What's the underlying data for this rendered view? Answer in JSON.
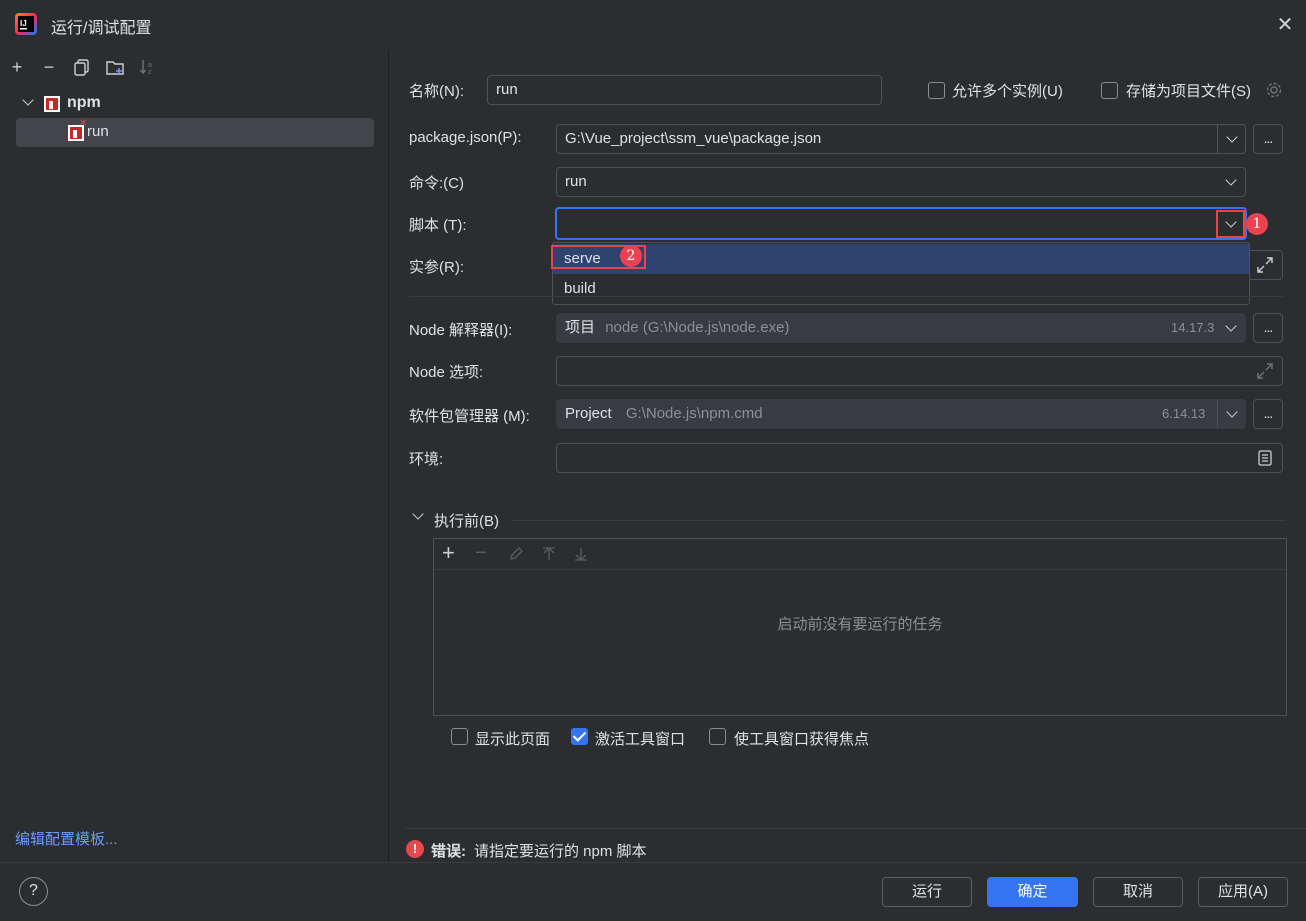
{
  "window": {
    "title": "运行/调试配置"
  },
  "tree": {
    "group_label": "npm",
    "config_label": "run"
  },
  "left_footer": {
    "edit_templates": "编辑配置模板..."
  },
  "form": {
    "name_label": "名称(N):",
    "name_value": "run",
    "allow_multiple_label": "允许多个实例(U)",
    "store_as_file_label": "存储为项目文件(S)",
    "package_json_label": "package.json(P):",
    "package_json_value": "G:\\Vue_project\\ssm_vue\\package.json",
    "command_label": "命令:(C)",
    "command_value": "run",
    "script_label": "脚本 (T):",
    "script_value": "",
    "args_label": "实参(R):",
    "script_options": [
      "serve",
      "build"
    ],
    "node_interpreter_label": "Node 解释器(I):",
    "node_interpreter_kind": "项目",
    "node_interpreter_path": "node (G:\\Node.js\\node.exe)",
    "node_interpreter_version": "14.17.3",
    "node_options_label": "Node 选项:",
    "package_manager_label": "软件包管理器 (M):",
    "package_manager_kind": "Project",
    "package_manager_path": "G:\\Node.js\\npm.cmd",
    "package_manager_version": "6.14.13",
    "env_label": "环境:"
  },
  "before_launch": {
    "header": "执行前(B)",
    "empty_text": "启动前没有要运行的任务",
    "show_page_label": "显示此页面",
    "show_page_checked": false,
    "activate_window_label": "激活工具窗口",
    "activate_window_checked": true,
    "focus_window_label": "使工具窗口获得焦点",
    "focus_window_checked": false
  },
  "error": {
    "prefix": "错误:",
    "message": "请指定要运行的 npm 脚本"
  },
  "annotations": {
    "badge1": "1",
    "badge2": "2",
    "highlight_color": "#e8434f"
  },
  "buttons": {
    "run": "运行",
    "ok": "确定",
    "cancel": "取消",
    "apply": "应用(A)"
  },
  "colors": {
    "accent": "#3574f0",
    "link": "#6b9bfa",
    "error": "#e5484d",
    "npm": "#c62828"
  }
}
